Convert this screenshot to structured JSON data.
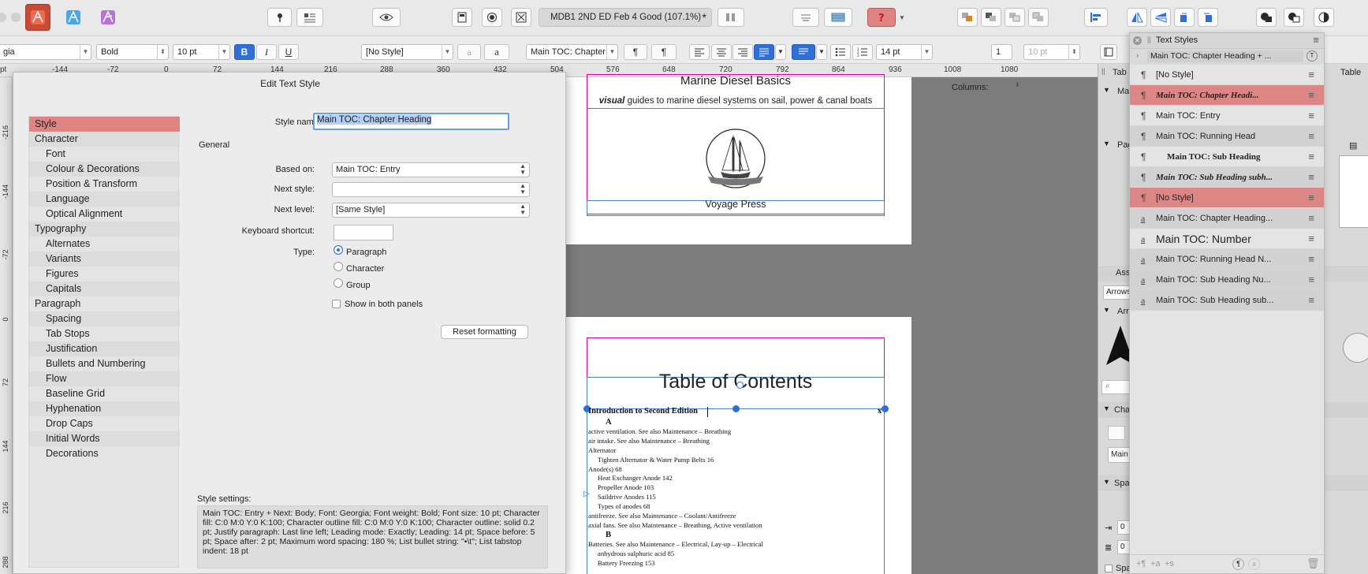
{
  "document": {
    "tab_title": "MDB1  2ND ED Feb 4 Good (107.1%)",
    "tab_mark": "*"
  },
  "context": {
    "font_name": "gia",
    "font_weight": "Bold",
    "font_size": "10 pt",
    "bold": "B",
    "italic": "I",
    "underline": "U",
    "char_style": "[No Style]",
    "char_a": "a",
    "para_style": "Main TOC: Chapter",
    "pilcrow": "¶",
    "leading": "14 pt",
    "columns_label": "Columns:",
    "columns": "1",
    "gutter": "10 pt"
  },
  "ruler": {
    "labels": [
      "pt",
      "-144",
      "-72",
      "0",
      "72",
      "144",
      "216",
      "288",
      "360",
      "432",
      "504",
      "576",
      "648",
      "720",
      "792",
      "864",
      "936",
      "1008",
      "1080"
    ]
  },
  "vruler": {
    "labels": [
      "-216",
      "-144",
      "-72",
      "0",
      "72",
      "144",
      "216",
      "288"
    ]
  },
  "dialog": {
    "title": "Edit Text Style",
    "style_name_label": "Style name:",
    "style_name": "Main TOC: Chapter Heading",
    "general": "General",
    "based_on_label": "Based on:",
    "based_on": "Main TOC: Entry",
    "next_style_label": "Next style:",
    "next_style": "",
    "next_level_label": "Next level:",
    "next_level": "[Same Style]",
    "shortcut_label": "Keyboard shortcut:",
    "type_label": "Type:",
    "type_options": [
      "Paragraph",
      "Character",
      "Group"
    ],
    "show_both": "Show in both panels",
    "reset": "Reset formatting",
    "settings_label": "Style settings:",
    "settings_text": "Main TOC: Entry + Next: Body; Font: Georgia; Font weight: Bold; Font size: 10 pt; Character fill: C:0 M:0 Y:0 K:100; Character outline fill: C:0 M:0 Y:0 K:100; Character outline: solid 0.2 pt; Justify paragraph: Last line left; Leading mode: Exactly; Leading: 14 pt; Space before: 5 pt; Space after: 2 pt; Maximum word spacing: 180 %; List bullet string: \"•\\t\"; List tabstop indent: 18 pt",
    "nav": [
      {
        "label": "Style",
        "sub": false
      },
      {
        "label": "Character",
        "sub": false
      },
      {
        "label": "Font",
        "sub": true
      },
      {
        "label": "Colour & Decorations",
        "sub": true
      },
      {
        "label": "Position & Transform",
        "sub": true
      },
      {
        "label": "Language",
        "sub": true
      },
      {
        "label": "Optical Alignment",
        "sub": true
      },
      {
        "label": "Typography",
        "sub": false
      },
      {
        "label": "Alternates",
        "sub": true
      },
      {
        "label": "Variants",
        "sub": true
      },
      {
        "label": "Figures",
        "sub": true
      },
      {
        "label": "Capitals",
        "sub": true
      },
      {
        "label": "Paragraph",
        "sub": false
      },
      {
        "label": "Spacing",
        "sub": true
      },
      {
        "label": "Tab Stops",
        "sub": true
      },
      {
        "label": "Justification",
        "sub": true
      },
      {
        "label": "Bullets and Numbering",
        "sub": true
      },
      {
        "label": "Flow",
        "sub": true
      },
      {
        "label": "Baseline Grid",
        "sub": true
      },
      {
        "label": "Hyphenation",
        "sub": true
      },
      {
        "label": "Drop Caps",
        "sub": true
      },
      {
        "label": "Initial Words",
        "sub": true
      },
      {
        "label": "Decorations",
        "sub": true
      }
    ]
  },
  "canvas": {
    "page1_title": "Marine Diesel Basics",
    "page1_sub_em": "visual",
    "page1_sub": " guides to marine diesel systems on sail, power & canal boats",
    "page1_publisher": "Voyage Press",
    "toc_title": "Table of Contents",
    "toc_chapter": "Introduction to Second Edition",
    "toc_chapter_num": "x",
    "toc_lines": [
      {
        "text": "A",
        "indent": 24,
        "bold": true
      },
      {
        "text": "active ventilation. See also Maintenance – Breathing",
        "indent": 2,
        "bold": false
      },
      {
        "text": "air intake. See also Maintenance – Breathing",
        "indent": 2,
        "bold": false
      },
      {
        "text": "Alternator",
        "indent": 2,
        "bold": false
      },
      {
        "text": "Tighten Alternator & Water Pump Belts  16",
        "indent": 14,
        "bold": false
      },
      {
        "text": "Anode(s)  68",
        "indent": 2,
        "bold": false
      },
      {
        "text": "Heat Exchanger Anode  142",
        "indent": 14,
        "bold": false
      },
      {
        "text": "Propeller Anode  103",
        "indent": 14,
        "bold": false
      },
      {
        "text": "Saildrive Anodes  115",
        "indent": 14,
        "bold": false
      },
      {
        "text": "Types of anodes  68",
        "indent": 14,
        "bold": false
      },
      {
        "text": "antifreeze. See also Maintenance – Coolant/Antifreeze",
        "indent": 2,
        "bold": false
      },
      {
        "text": "axial fans. See also Maintenance – Breathing, Active ventilation",
        "indent": 2,
        "bold": false
      },
      {
        "text": "B",
        "indent": 24,
        "bold": true
      },
      {
        "text": "Batteries. See also Maintenance – Electrical,  Lay-up  –  Electrical",
        "indent": 2,
        "bold": false
      },
      {
        "text": "anhydrous sulphuric acid  85",
        "indent": 14,
        "bold": false
      },
      {
        "text": "Battery Freezing  153",
        "indent": 14,
        "bold": false
      }
    ]
  },
  "text_styles": {
    "tab": "Text Styles",
    "current": "Main TOC: Chapter Heading + ...",
    "items": [
      {
        "icon": "¶",
        "name": "[No Style]",
        "state": "normal",
        "fmt": "plain"
      },
      {
        "icon": "¶",
        "name": "Main TOC: Chapter Headi...",
        "state": "selected",
        "fmt": "bolditalic"
      },
      {
        "icon": "¶",
        "name": "Main TOC: Entry",
        "state": "normal",
        "fmt": "plain"
      },
      {
        "icon": "¶",
        "name": "Main TOC: Running Head",
        "state": "group",
        "fmt": "plain"
      },
      {
        "icon": "¶",
        "name": "Main TOC: Sub Heading",
        "state": "normal",
        "fmt": "indentbold"
      },
      {
        "icon": "¶",
        "name": "Main TOC: Sub Heading subh...",
        "state": "group",
        "fmt": "bolditalic"
      },
      {
        "icon": "¶",
        "name": "[No Style]",
        "state": "selected",
        "fmt": "plain"
      },
      {
        "icon": "a",
        "name": "Main TOC: Chapter Heading...",
        "state": "group",
        "fmt": "plain"
      },
      {
        "icon": "a",
        "name": "Main TOC: Number",
        "state": "normal",
        "fmt": "large"
      },
      {
        "icon": "a",
        "name": "Main TOC: Running Head  N...",
        "state": "group",
        "fmt": "plain"
      },
      {
        "icon": "a",
        "name": "Main TOC: Sub Heading Nu...",
        "state": "group",
        "fmt": "plain"
      },
      {
        "icon": "a",
        "name": "Main TOC: Sub Heading sub...",
        "state": "group",
        "fmt": "plain"
      }
    ]
  },
  "right_panel": {
    "tab_table": "Tab",
    "tab_table2": "Table",
    "masters": "Mas",
    "pages": "Pag",
    "assets": "Ass",
    "arrows": "Arrows",
    "arr": "Arr",
    "cha": "Cha",
    "main": "Main",
    "spa": "Spa",
    "spa2": "Spa",
    "zero1": "0",
    "zero2": "0"
  },
  "colors": {
    "selection": "#e08383",
    "accent_blue": "#2f6fd6",
    "frame_magenta": "#e000a0"
  }
}
